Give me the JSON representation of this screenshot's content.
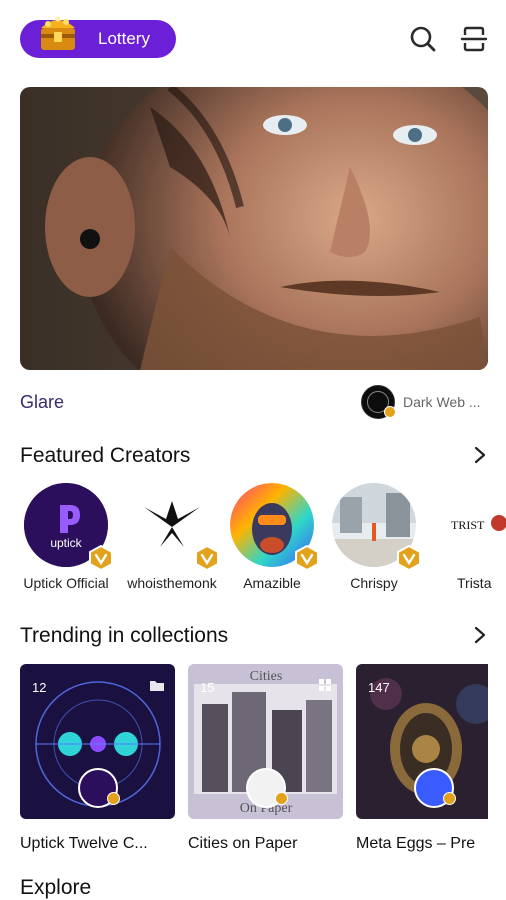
{
  "header": {
    "lottery_label": "Lottery",
    "search_icon": "search-icon",
    "menu_icon": "scan-frame-icon"
  },
  "hero": {
    "title": "Glare",
    "creator_name": "Dark Web ..."
  },
  "featured_creators": {
    "title": "Featured Creators",
    "items": [
      {
        "name": "Uptick Official"
      },
      {
        "name": "whoisthemonk"
      },
      {
        "name": "Amazible"
      },
      {
        "name": "Chrispy"
      },
      {
        "name": "Trista"
      }
    ]
  },
  "trending": {
    "title": "Trending in collections",
    "items": [
      {
        "name": "Uptick Twelve C...",
        "count": "12"
      },
      {
        "name": "Cities on Paper",
        "count": "15"
      },
      {
        "name": "Meta Eggs – Pre",
        "count": "147"
      }
    ]
  },
  "explore": {
    "title": "Explore"
  },
  "colors": {
    "accent": "#6b1fd6",
    "badge": "#e2a21b",
    "hero_title": "#3a2a6d"
  }
}
